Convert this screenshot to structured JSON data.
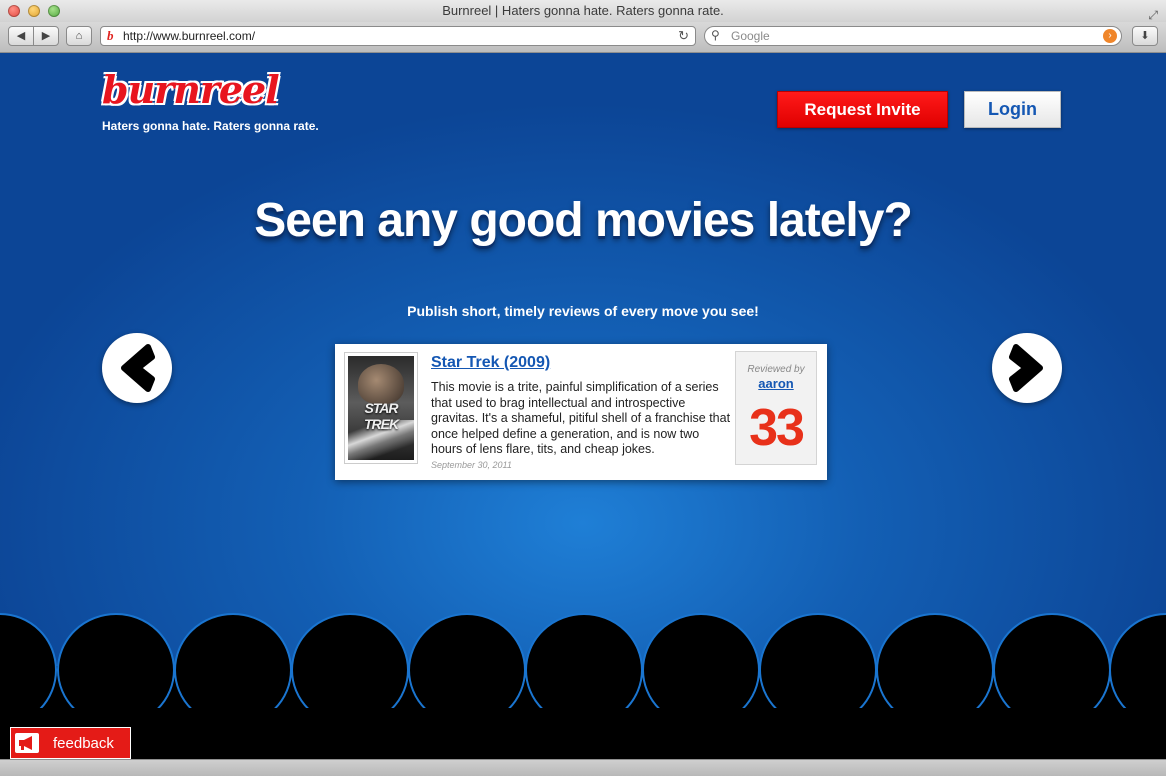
{
  "browser": {
    "window_title": "Burnreel | Haters gonna hate. Raters gonna rate.",
    "url": "http://www.burnreel.com/",
    "search_placeholder": "Google",
    "favicon_letter": "b"
  },
  "header": {
    "logo_text": "burnreel",
    "tagline": "Haters gonna hate. Raters gonna rate.",
    "request_invite_label": "Request Invite",
    "login_label": "Login"
  },
  "hero": {
    "headline": "Seen any good movies lately?",
    "subhead": "Publish short, timely reviews of every move you see!"
  },
  "review_card": {
    "poster_text": "STAR TREK",
    "movie_title": "Star Trek (2009)",
    "review_text": "This movie is a trite, painful simplification of a series that used to brag intellectual and introspective gravitas. It's a shameful, pitiful shell of a franchise that once helped define a generation, and is now two hours of lens flare, tits, and cheap jokes.",
    "date": "September 30, 2011",
    "reviewed_by_label": "Reviewed by",
    "reviewer": "aaron",
    "score": "33"
  },
  "feedback_label": "feedback",
  "colors": {
    "brand_red": "#e8151f",
    "link_blue": "#1457b3",
    "page_blue": "#135fb4",
    "score_red": "#e8311a"
  },
  "icons": [
    "home-icon",
    "back-arrow-icon",
    "forward-arrow-icon",
    "reload-icon",
    "search-icon",
    "download-icon",
    "left-arrow-icon",
    "right-arrow-icon",
    "megaphone-icon"
  ]
}
